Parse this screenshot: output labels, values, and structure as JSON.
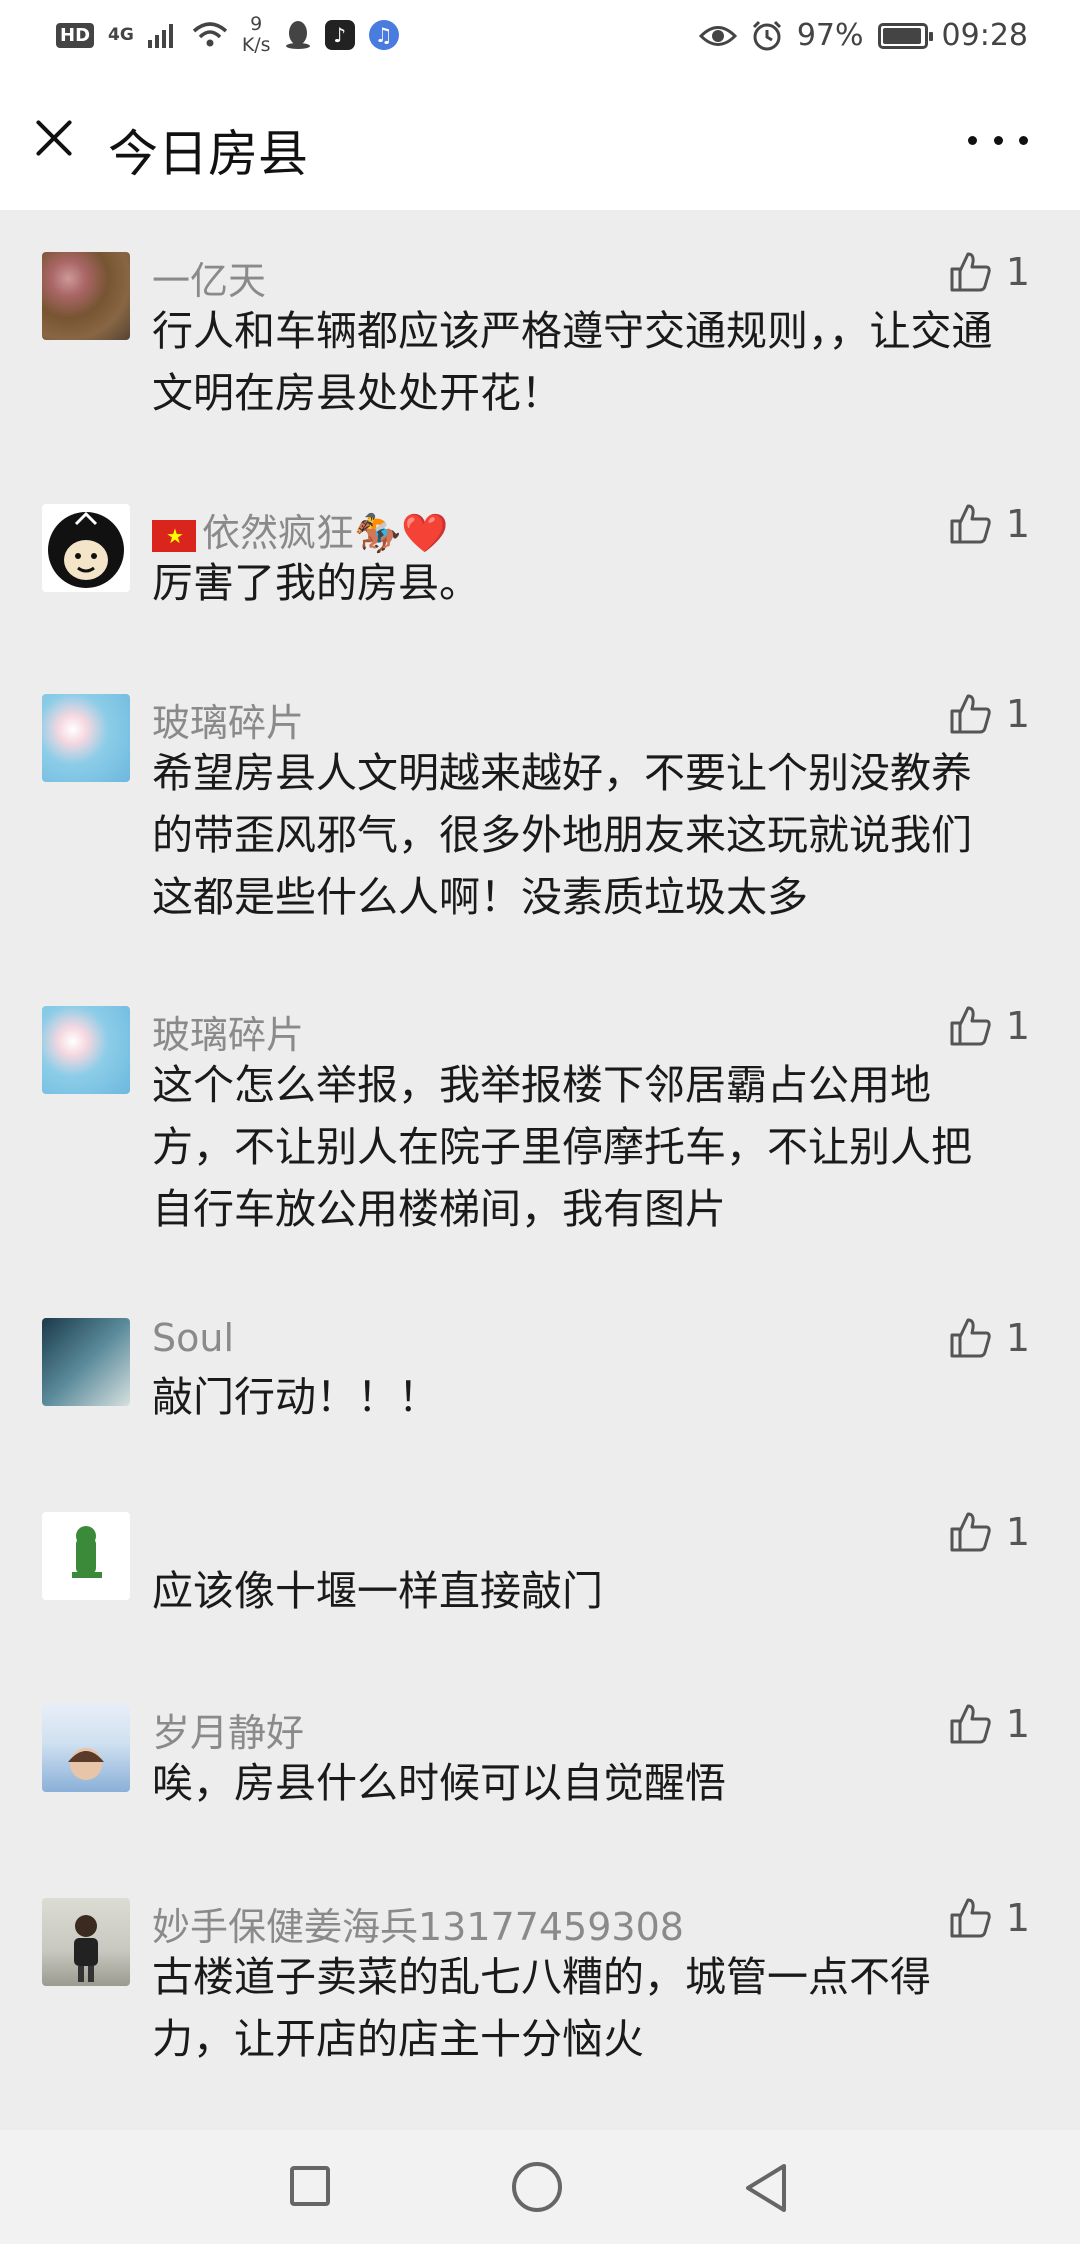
{
  "status_bar": {
    "hd": "HD",
    "network": "4G",
    "speed_value": "9",
    "speed_unit": "K/s",
    "battery": "97%",
    "time": "09:28"
  },
  "header": {
    "title": "今日房县"
  },
  "comments": [
    {
      "name": "一亿天",
      "text": "行人和车辆都应该严格遵守交通规则，，让交通文明在房县处处开花！",
      "likes": "1"
    },
    {
      "name": "依然疯狂🏇❤️",
      "text": "厉害了我的房县。",
      "likes": "1"
    },
    {
      "name": "玻璃碎片",
      "text": "希望房县人文明越来越好，不要让个别没教养的带歪风邪气，很多外地朋友来这玩就说我们这都是些什么人啊！没素质垃圾太多",
      "likes": "1"
    },
    {
      "name": "玻璃碎片",
      "text": "这个怎么举报，我举报楼下邻居霸占公用地方，不让别人在院子里停摩托车，不让别人把自行车放公用楼梯间，我有图片",
      "likes": "1"
    },
    {
      "name": "Soul",
      "text": "敲门行动！！！",
      "likes": "1"
    },
    {
      "name": "",
      "text": "应该像十堰一样直接敲门",
      "likes": "1"
    },
    {
      "name": "岁月静好",
      "text": "唉，房县什么时候可以自觉醒悟",
      "likes": "1"
    },
    {
      "name": "妙手保健姜海兵13177459308",
      "text": "古楼道子卖菜的乱七八糟的，城管一点不得力，让开店的店主十分恼火",
      "likes": "1"
    }
  ],
  "colors": {
    "background": "#ededed",
    "name_gray": "#8a8a8a",
    "text": "#1a1a1a"
  },
  "icons": {
    "close": "close-icon",
    "more": "more-icon",
    "like": "thumbs-up-icon"
  }
}
